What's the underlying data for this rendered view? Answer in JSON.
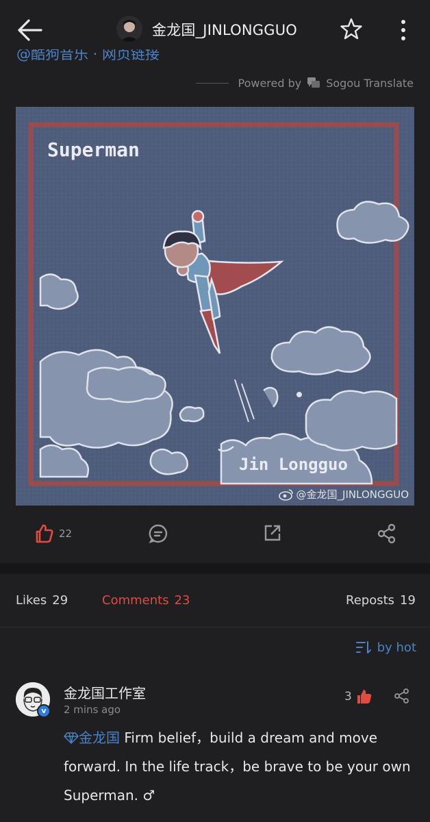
{
  "header": {
    "title": "金龙国_JINLONGGUO",
    "icons": [
      "back-arrow-icon",
      "avatar",
      "star-icon",
      "more-vertical-icon"
    ]
  },
  "post": {
    "link_text_cut": "@酷狗音乐 · 网页链接",
    "powered_by": "Powered by",
    "translator": "Sogou Translate",
    "image": {
      "title_text": "Superman",
      "signature": "Jin  Longguo",
      "watermark": "@金龙国_JINLONGGUO"
    },
    "actions": {
      "like_count": "22",
      "icons": [
        "like-icon",
        "comment-icon",
        "repost-icon",
        "share-icon"
      ]
    }
  },
  "tabs": {
    "likes_label": "Likes",
    "likes_count": "29",
    "comments_label": "Comments",
    "comments_count": "23",
    "reposts_label": "Reposts",
    "reposts_count": "19"
  },
  "sort": {
    "label": "by hot"
  },
  "comment": {
    "author": "金龙国工作室",
    "time": "2  mins ago",
    "likes": "3",
    "mention": "金龙国",
    "text": " Firm belief，build a dream and move forward.  In the life track，be brave to be your own Superman. ♂"
  },
  "colors": {
    "background": "#1f1f21",
    "accent_red": "#e24a42",
    "link_blue": "#4a83c7",
    "art_blue": "#4f5d7c",
    "frame_red": "#9a4b4e"
  }
}
